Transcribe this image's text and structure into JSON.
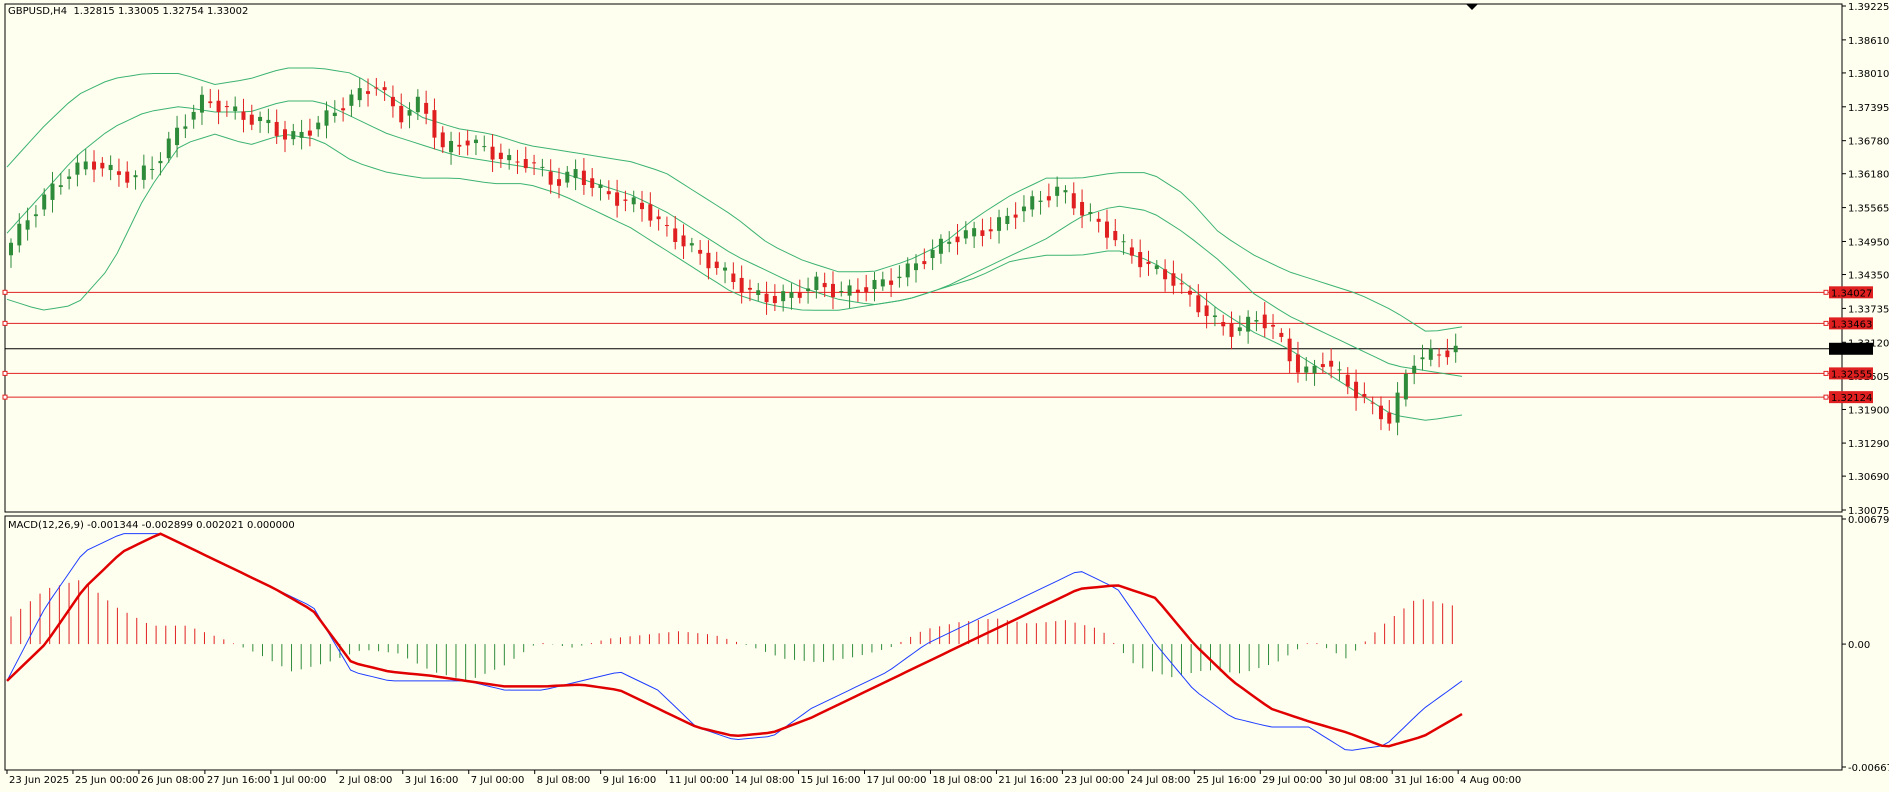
{
  "window": {
    "symbol_label": "GBPUSD,H4",
    "ohlc_label": "1.32815 1.33005 1.32754 1.33002",
    "indicator_label": "MACD(12,26,9) -0.001344 -0.002899 0.002021 0.000000"
  },
  "colors": {
    "background": "#FFFFF0",
    "bull_candle": "#2E8B3A",
    "bear_candle": "#E02020",
    "bands": "#3CB371",
    "hlines": "#E02020",
    "macd_main": "#1E3DFF",
    "macd_signal": "#E00000",
    "hist_pos": "#E02020",
    "hist_neg": "#2E8B3A"
  },
  "chart_data": [
    {
      "type": "candlestick",
      "title": "GBPUSD,H4",
      "ylim": [
        1.30075,
        1.39225
      ],
      "y_ticks": [
        "1.39225",
        "1.38610",
        "1.38010",
        "1.37395",
        "1.36780",
        "1.36180",
        "1.35565",
        "1.34950",
        "1.34350",
        "1.33735",
        "1.33120",
        "1.32505",
        "1.31900",
        "1.31290",
        "1.30690",
        "1.30075"
      ],
      "x_ticks": [
        "23 Jun 2025",
        "25 Jun 00:00",
        "26 Jun 08:00",
        "27 Jun 16:00",
        "1 Jul 00:00",
        "2 Jul 08:00",
        "3 Jul 16:00",
        "7 Jul 00:00",
        "8 Jul 08:00",
        "9 Jul 16:00",
        "11 Jul 00:00",
        "14 Jul 08:00",
        "15 Jul 16:00",
        "17 Jul 00:00",
        "18 Jul 08:00",
        "21 Jul 16:00",
        "23 Jul 00:00",
        "24 Jul 08:00",
        "25 Jul 16:00",
        "29 Jul 00:00",
        "30 Jul 08:00",
        "31 Jul 16:00",
        "4 Aug 00:00"
      ],
      "current_price": "1.33002",
      "horizontal_lines": [
        "1.34027",
        "1.33463",
        "1.32555",
        "1.32124"
      ],
      "close_path": [
        1.347,
        1.353,
        1.358,
        1.362,
        1.364,
        1.362,
        1.361,
        1.364,
        1.37,
        1.375,
        1.374,
        1.372,
        1.371,
        1.368,
        1.37,
        1.373,
        1.376,
        1.378,
        1.372,
        1.375,
        1.366,
        1.368,
        1.366,
        1.364,
        1.364,
        1.36,
        1.362,
        1.359,
        1.357,
        1.356,
        1.352,
        1.349,
        1.346,
        1.343,
        1.34,
        1.339,
        1.34,
        1.342,
        1.34,
        1.341,
        1.342,
        1.344,
        1.347,
        1.35,
        1.351,
        1.352,
        1.355,
        1.357,
        1.359,
        1.355,
        1.352,
        1.348,
        1.345,
        1.343,
        1.339,
        1.335,
        1.333,
        1.336,
        1.332,
        1.325,
        1.328,
        1.324,
        1.32,
        1.317,
        1.328,
        1.329,
        1.33
      ],
      "bands_upper": [
        1.363,
        1.37,
        1.376,
        1.379,
        1.38,
        1.38,
        1.378,
        1.379,
        1.381,
        1.381,
        1.38,
        1.376,
        1.372,
        1.37,
        1.369,
        1.367,
        1.366,
        1.365,
        1.364,
        1.362,
        1.358,
        1.354,
        1.349,
        1.346,
        1.344,
        1.344,
        1.346,
        1.349,
        1.354,
        1.358,
        1.361,
        1.361,
        1.362,
        1.362,
        1.358,
        1.351,
        1.347,
        1.344,
        1.342,
        1.34,
        1.337,
        1.333,
        1.334
      ],
      "bands_middle": [
        1.351,
        1.358,
        1.365,
        1.37,
        1.373,
        1.374,
        1.373,
        1.373,
        1.375,
        1.375,
        1.372,
        1.369,
        1.367,
        1.365,
        1.364,
        1.363,
        1.362,
        1.36,
        1.358,
        1.355,
        1.351,
        1.347,
        1.344,
        1.341,
        1.339,
        1.338,
        1.339,
        1.341,
        1.344,
        1.347,
        1.35,
        1.354,
        1.356,
        1.355,
        1.351,
        1.346,
        1.34,
        1.336,
        1.333,
        1.33,
        1.327,
        1.326,
        1.325
      ],
      "bands_lower": [
        1.339,
        1.337,
        1.338,
        1.345,
        1.358,
        1.367,
        1.369,
        1.367,
        1.369,
        1.368,
        1.364,
        1.362,
        1.361,
        1.361,
        1.36,
        1.36,
        1.358,
        1.355,
        1.352,
        1.348,
        1.344,
        1.34,
        1.338,
        1.337,
        1.337,
        1.338,
        1.339,
        1.341,
        1.343,
        1.346,
        1.347,
        1.347,
        1.348,
        1.346,
        1.342,
        1.337,
        1.333,
        1.33,
        1.326,
        1.322,
        1.318,
        1.317,
        1.318
      ]
    },
    {
      "type": "line",
      "title": "MACD(12,26,9)",
      "ylim": [
        -0.006674,
        0.006791
      ],
      "y_ticks": [
        "0.006791",
        "0.00",
        "-0.006674"
      ],
      "series": [
        {
          "name": "main",
          "values": [
            -0.002,
            0.002,
            0.005,
            0.006,
            0.006,
            0.005,
            0.004,
            0.003,
            0.002,
            -0.0015,
            -0.002,
            -0.002,
            -0.002,
            -0.0025,
            -0.0025,
            -0.002,
            -0.0015,
            -0.0025,
            -0.0045,
            -0.0052,
            -0.005,
            -0.0035,
            -0.0025,
            -0.0015,
            0.0,
            0.001,
            0.002,
            0.003,
            0.004,
            0.003,
            0.0,
            -0.0025,
            -0.004,
            -0.0045,
            -0.0045,
            -0.0058,
            -0.0055,
            -0.0035,
            -0.002
          ]
        },
        {
          "name": "signal",
          "values": [
            -0.002,
            0.0,
            0.003,
            0.005,
            0.006,
            0.005,
            0.004,
            0.003,
            0.0018,
            -0.001,
            -0.0015,
            -0.0017,
            -0.002,
            -0.0023,
            -0.0023,
            -0.0022,
            -0.0025,
            -0.0035,
            -0.0045,
            -0.005,
            -0.0048,
            -0.004,
            -0.003,
            -0.002,
            -0.001,
            0.0,
            0.001,
            0.002,
            0.003,
            0.0032,
            0.0025,
            0.0,
            -0.002,
            -0.0035,
            -0.0042,
            -0.0048,
            -0.0056,
            -0.005,
            -0.0038
          ]
        },
        {
          "name": "histogram",
          "values": [
            0.0015,
            0.003,
            0.0035,
            0.002,
            0.001,
            0.001,
            0.0003,
            -0.0005,
            -0.0015,
            -0.001,
            -0.0003,
            -0.0005,
            -0.0015,
            -0.002,
            -0.0012,
            0.0001,
            -0.0002,
            0.0003,
            0.0005,
            0.0007,
            0.0005,
            -0.0001,
            -0.0008,
            -0.001,
            -0.0007,
            -0.0002,
            0.0008,
            0.0012,
            0.0014,
            0.0011,
            0.0013,
            0.0008,
            -0.0012,
            -0.0018,
            -0.0014,
            -0.0016,
            -0.001,
            0.0002,
            -0.0008,
            0.001,
            0.0025,
            0.0021
          ]
        }
      ]
    }
  ]
}
